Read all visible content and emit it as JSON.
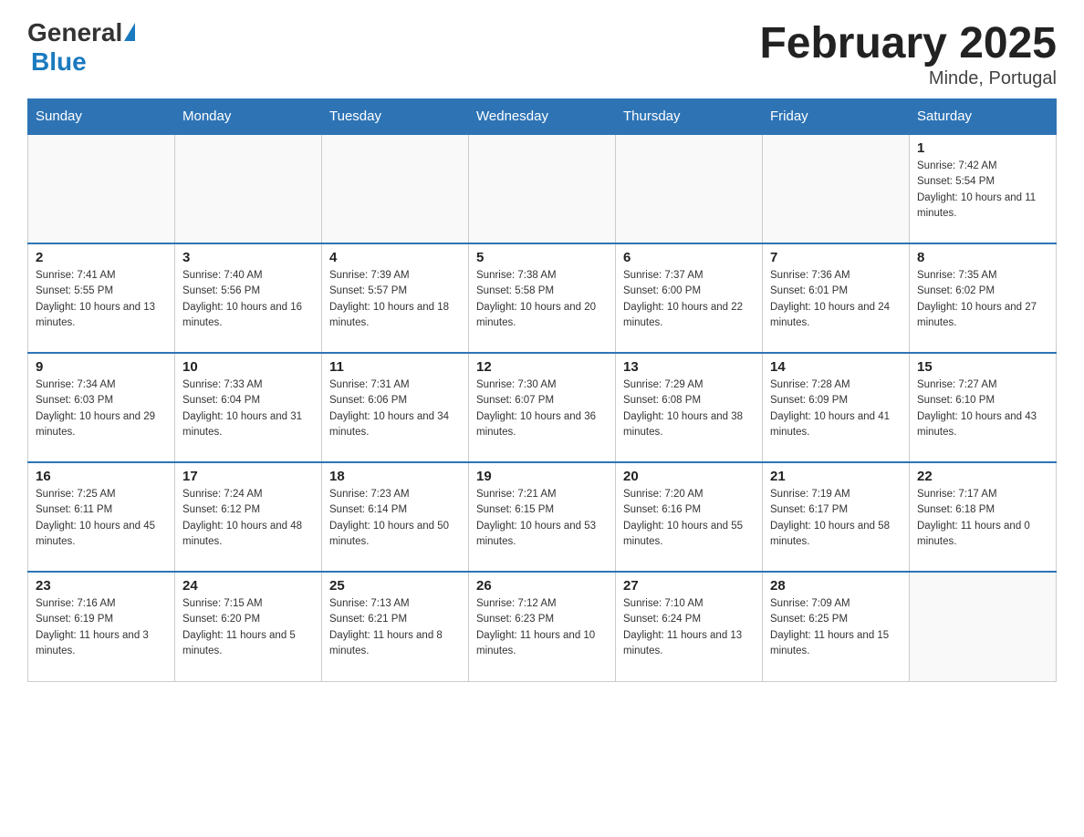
{
  "header": {
    "logo_general": "General",
    "logo_triangle": "▶",
    "logo_blue": "Blue",
    "title": "February 2025",
    "location": "Minde, Portugal"
  },
  "weekdays": [
    "Sunday",
    "Monday",
    "Tuesday",
    "Wednesday",
    "Thursday",
    "Friday",
    "Saturday"
  ],
  "weeks": [
    [
      {
        "day": "",
        "info": ""
      },
      {
        "day": "",
        "info": ""
      },
      {
        "day": "",
        "info": ""
      },
      {
        "day": "",
        "info": ""
      },
      {
        "day": "",
        "info": ""
      },
      {
        "day": "",
        "info": ""
      },
      {
        "day": "1",
        "info": "Sunrise: 7:42 AM\nSunset: 5:54 PM\nDaylight: 10 hours and 11 minutes."
      }
    ],
    [
      {
        "day": "2",
        "info": "Sunrise: 7:41 AM\nSunset: 5:55 PM\nDaylight: 10 hours and 13 minutes."
      },
      {
        "day": "3",
        "info": "Sunrise: 7:40 AM\nSunset: 5:56 PM\nDaylight: 10 hours and 16 minutes."
      },
      {
        "day": "4",
        "info": "Sunrise: 7:39 AM\nSunset: 5:57 PM\nDaylight: 10 hours and 18 minutes."
      },
      {
        "day": "5",
        "info": "Sunrise: 7:38 AM\nSunset: 5:58 PM\nDaylight: 10 hours and 20 minutes."
      },
      {
        "day": "6",
        "info": "Sunrise: 7:37 AM\nSunset: 6:00 PM\nDaylight: 10 hours and 22 minutes."
      },
      {
        "day": "7",
        "info": "Sunrise: 7:36 AM\nSunset: 6:01 PM\nDaylight: 10 hours and 24 minutes."
      },
      {
        "day": "8",
        "info": "Sunrise: 7:35 AM\nSunset: 6:02 PM\nDaylight: 10 hours and 27 minutes."
      }
    ],
    [
      {
        "day": "9",
        "info": "Sunrise: 7:34 AM\nSunset: 6:03 PM\nDaylight: 10 hours and 29 minutes."
      },
      {
        "day": "10",
        "info": "Sunrise: 7:33 AM\nSunset: 6:04 PM\nDaylight: 10 hours and 31 minutes."
      },
      {
        "day": "11",
        "info": "Sunrise: 7:31 AM\nSunset: 6:06 PM\nDaylight: 10 hours and 34 minutes."
      },
      {
        "day": "12",
        "info": "Sunrise: 7:30 AM\nSunset: 6:07 PM\nDaylight: 10 hours and 36 minutes."
      },
      {
        "day": "13",
        "info": "Sunrise: 7:29 AM\nSunset: 6:08 PM\nDaylight: 10 hours and 38 minutes."
      },
      {
        "day": "14",
        "info": "Sunrise: 7:28 AM\nSunset: 6:09 PM\nDaylight: 10 hours and 41 minutes."
      },
      {
        "day": "15",
        "info": "Sunrise: 7:27 AM\nSunset: 6:10 PM\nDaylight: 10 hours and 43 minutes."
      }
    ],
    [
      {
        "day": "16",
        "info": "Sunrise: 7:25 AM\nSunset: 6:11 PM\nDaylight: 10 hours and 45 minutes."
      },
      {
        "day": "17",
        "info": "Sunrise: 7:24 AM\nSunset: 6:12 PM\nDaylight: 10 hours and 48 minutes."
      },
      {
        "day": "18",
        "info": "Sunrise: 7:23 AM\nSunset: 6:14 PM\nDaylight: 10 hours and 50 minutes."
      },
      {
        "day": "19",
        "info": "Sunrise: 7:21 AM\nSunset: 6:15 PM\nDaylight: 10 hours and 53 minutes."
      },
      {
        "day": "20",
        "info": "Sunrise: 7:20 AM\nSunset: 6:16 PM\nDaylight: 10 hours and 55 minutes."
      },
      {
        "day": "21",
        "info": "Sunrise: 7:19 AM\nSunset: 6:17 PM\nDaylight: 10 hours and 58 minutes."
      },
      {
        "day": "22",
        "info": "Sunrise: 7:17 AM\nSunset: 6:18 PM\nDaylight: 11 hours and 0 minutes."
      }
    ],
    [
      {
        "day": "23",
        "info": "Sunrise: 7:16 AM\nSunset: 6:19 PM\nDaylight: 11 hours and 3 minutes."
      },
      {
        "day": "24",
        "info": "Sunrise: 7:15 AM\nSunset: 6:20 PM\nDaylight: 11 hours and 5 minutes."
      },
      {
        "day": "25",
        "info": "Sunrise: 7:13 AM\nSunset: 6:21 PM\nDaylight: 11 hours and 8 minutes."
      },
      {
        "day": "26",
        "info": "Sunrise: 7:12 AM\nSunset: 6:23 PM\nDaylight: 11 hours and 10 minutes."
      },
      {
        "day": "27",
        "info": "Sunrise: 7:10 AM\nSunset: 6:24 PM\nDaylight: 11 hours and 13 minutes."
      },
      {
        "day": "28",
        "info": "Sunrise: 7:09 AM\nSunset: 6:25 PM\nDaylight: 11 hours and 15 minutes."
      },
      {
        "day": "",
        "info": ""
      }
    ]
  ]
}
